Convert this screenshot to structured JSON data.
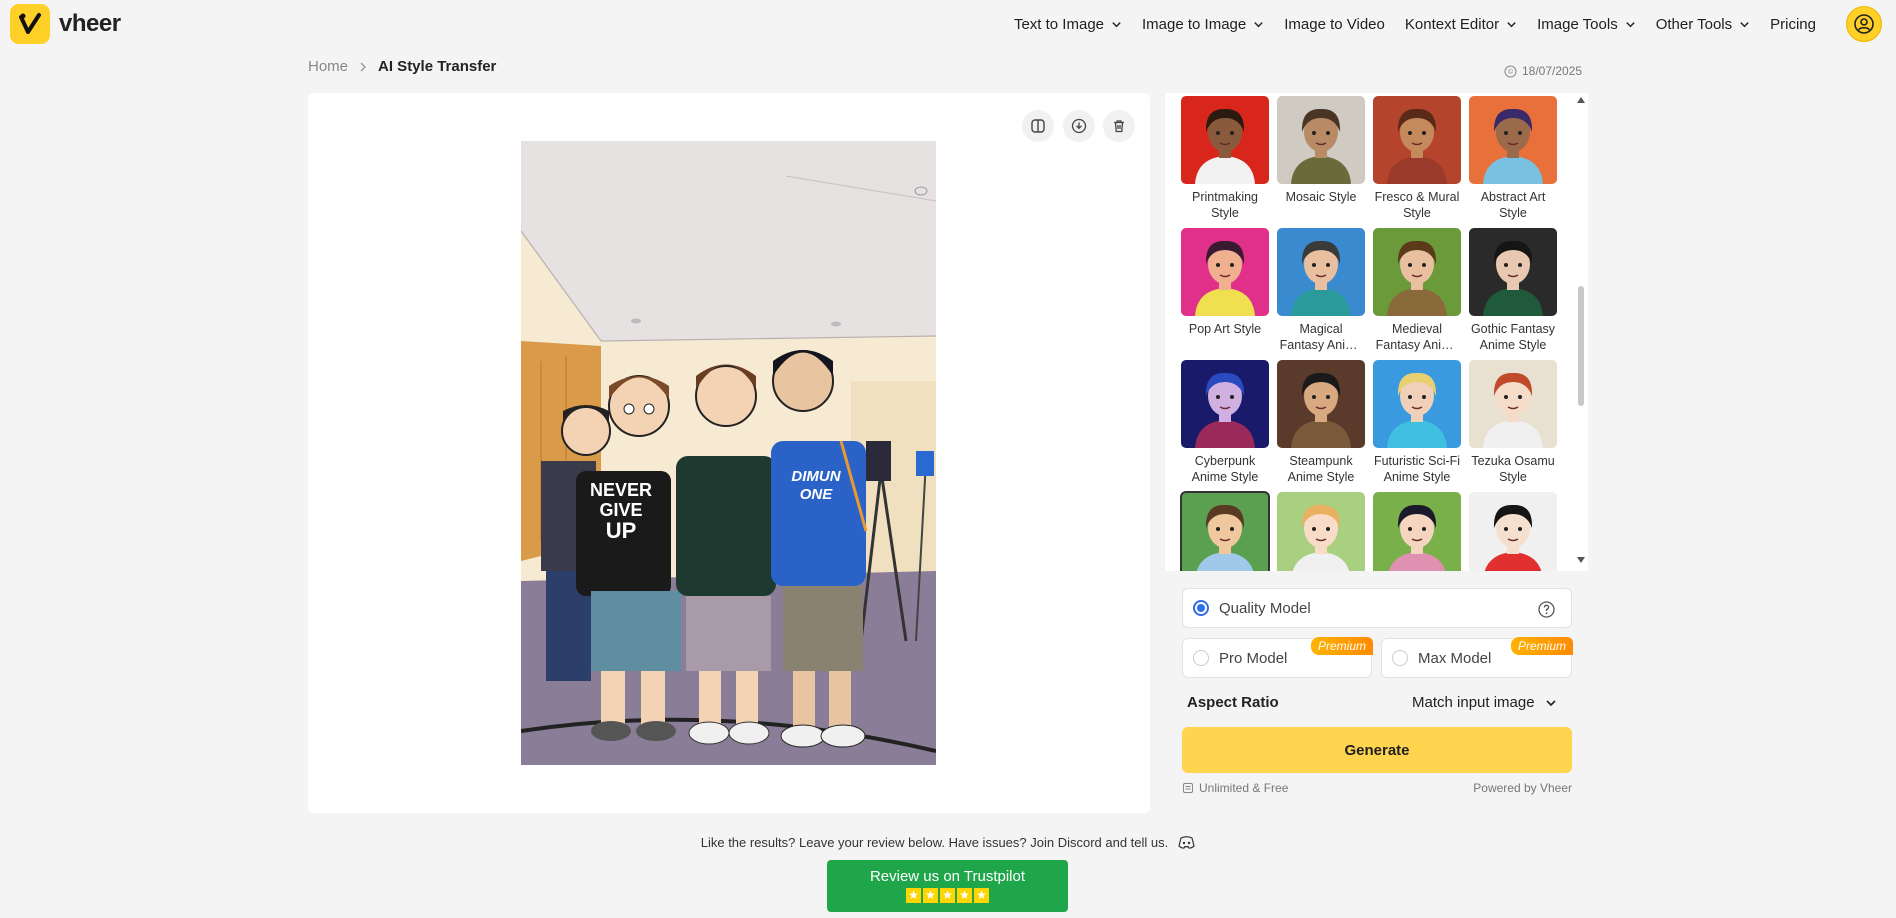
{
  "brand": {
    "name": "vheer"
  },
  "nav": {
    "items": [
      {
        "label": "Text to Image",
        "dropdown": true
      },
      {
        "label": "Image to Image",
        "dropdown": true
      },
      {
        "label": "Image to Video",
        "dropdown": false
      },
      {
        "label": "Kontext Editor",
        "dropdown": true
      },
      {
        "label": "Image Tools",
        "dropdown": true
      },
      {
        "label": "Other Tools",
        "dropdown": true
      },
      {
        "label": "Pricing",
        "dropdown": false
      }
    ]
  },
  "breadcrumb": {
    "home": "Home",
    "current": "AI Style Transfer"
  },
  "date": "18/07/2025",
  "styles": [
    {
      "label": "Printmaking Style",
      "bg": "#d9261c",
      "skin": "#8a5a3c",
      "hair": "#2b1a10",
      "shirt": "#f2f2f2"
    },
    {
      "label": "Mosaic Style",
      "bg": "#cfcac2",
      "skin": "#b98a66",
      "hair": "#4a3424",
      "shirt": "#6a6a3a"
    },
    {
      "label": "Fresco & Mural Style",
      "bg": "#b5442c",
      "skin": "#c58a5c",
      "hair": "#5a2a18",
      "shirt": "#9a3a2a"
    },
    {
      "label": "Abstract Art Style",
      "bg": "#e8703a",
      "skin": "#9a6a4a",
      "hair": "#3a2a6a",
      "shirt": "#7ac0e0"
    },
    {
      "label": "Pop Art Style",
      "bg": "#e0308a",
      "skin": "#f0b090",
      "hair": "#3a1a30",
      "shirt": "#f0e050"
    },
    {
      "label": "Magical Fantasy Anime Style",
      "bg": "#3a8ad0",
      "skin": "#e8c0a0",
      "hair": "#3a3a3a",
      "shirt": "#2a9a9a"
    },
    {
      "label": "Medieval Fantasy Anime Style",
      "bg": "#6a9a3a",
      "skin": "#e8c0a0",
      "hair": "#5a3a1a",
      "shirt": "#8a6a3a"
    },
    {
      "label": "Gothic Fantasy Anime Style",
      "bg": "#2a2a2a",
      "skin": "#e8c8b0",
      "hair": "#151515",
      "shirt": "#1f5a3a"
    },
    {
      "label": "Cyberpunk Anime Style",
      "bg": "#1a1a6a",
      "skin": "#d0b0e0",
      "hair": "#2a4ac0",
      "shirt": "#9a2a5a"
    },
    {
      "label": "Steampunk Anime Style",
      "bg": "#5a3a2a",
      "skin": "#d8a880",
      "hair": "#1a1a1a",
      "shirt": "#7a5a3a"
    },
    {
      "label": "Futuristic Sci-Fi Anime Style",
      "bg": "#3a9ae0",
      "skin": "#f0d0b8",
      "hair": "#e8d070",
      "shirt": "#40c0e0"
    },
    {
      "label": "Tezuka Osamu Style",
      "bg": "#e8e0d0",
      "skin": "#f5dcc8",
      "hair": "#c04a2a",
      "shirt": "#f0f0f0"
    },
    {
      "label": "",
      "bg": "#5aa050",
      "skin": "#f0c8a0",
      "hair": "#5a3a20",
      "shirt": "#a0c8e8",
      "selected": true
    },
    {
      "label": "",
      "bg": "#a8d080",
      "skin": "#f8dcc8",
      "hair": "#e8b060",
      "shirt": "#f0f0f0"
    },
    {
      "label": "",
      "bg": "#7ab04a",
      "skin": "#f5d5c0",
      "hair": "#1a1a2a",
      "shirt": "#e090b0"
    },
    {
      "label": "",
      "bg": "#f0f0f0",
      "skin": "#f5e0d0",
      "hair": "#151515",
      "shirt": "#e03030"
    }
  ],
  "models": {
    "quality": "Quality Model",
    "pro": "Pro Model",
    "max": "Max Model",
    "premium_badge": "Premium"
  },
  "aspect": {
    "label": "Aspect Ratio",
    "value": "Match input image"
  },
  "generate_label": "Generate",
  "footer": {
    "left": "Unlimited & Free",
    "right": "Powered by Vheer"
  },
  "review": {
    "note": "Like the results? Leave your review below. Have issues? Join Discord and tell us.",
    "button": "Review us on Trustpilot"
  },
  "colors": {
    "accent": "#ffd027",
    "trustpilot": "#1fa64b",
    "radio": "#2f6fe6"
  }
}
